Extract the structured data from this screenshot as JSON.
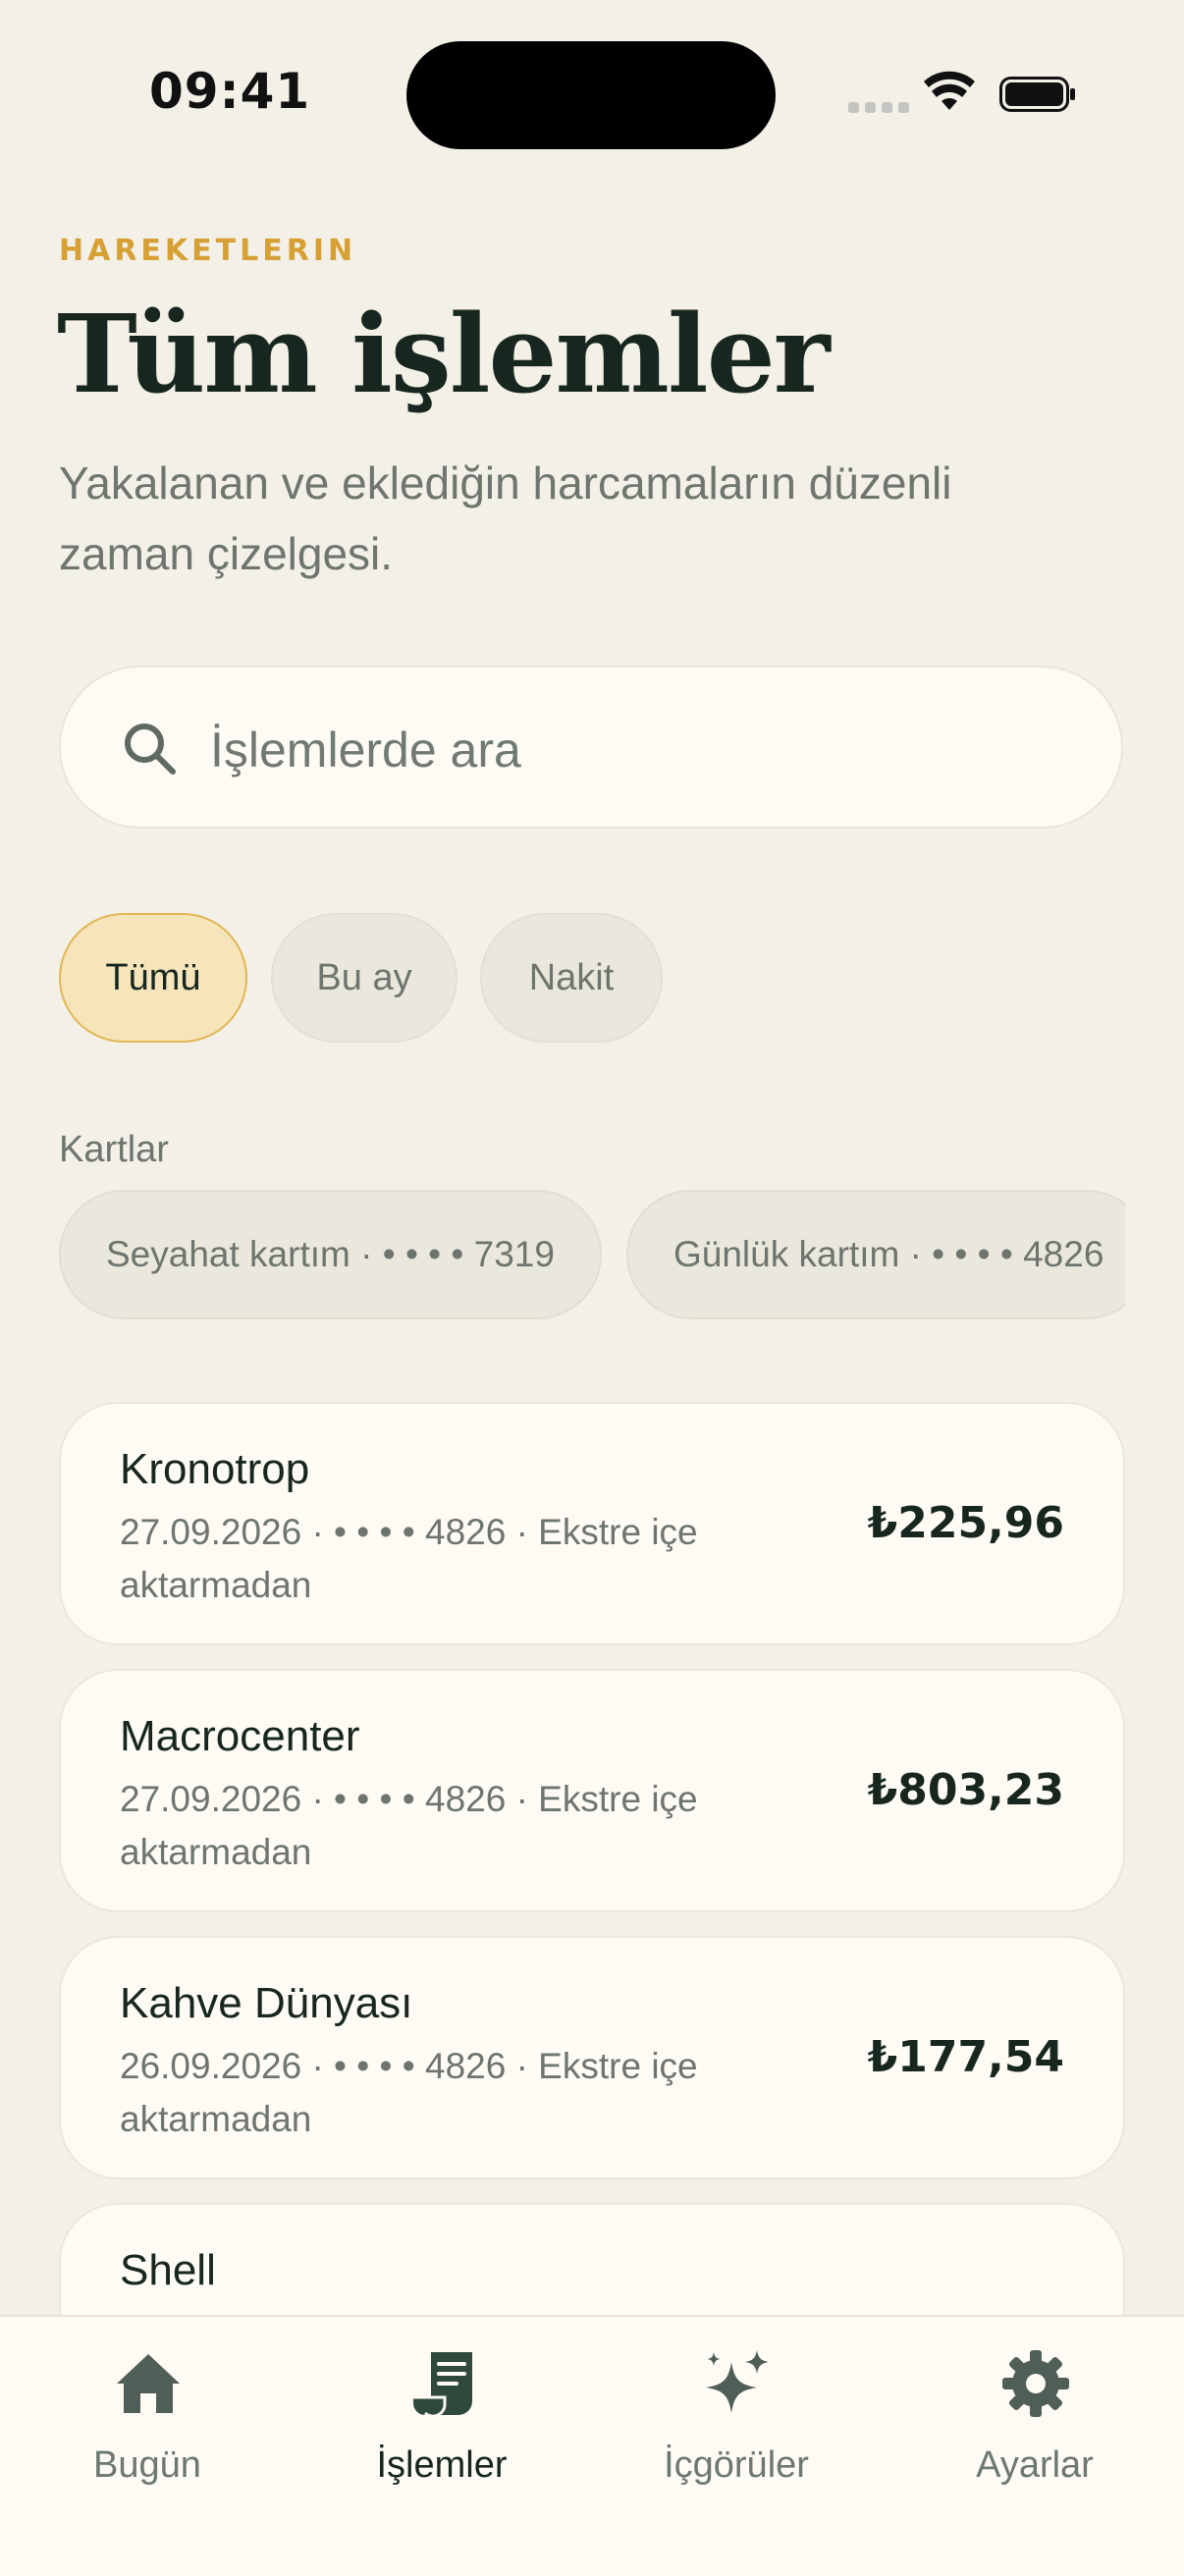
{
  "status_bar": {
    "time": "09:41"
  },
  "header": {
    "eyebrow": "HAREKETLERIN",
    "title": "Tüm işlemler",
    "subtitle": "Yakalanan ve eklediğin harcamaların düzenli zaman çizelgesi."
  },
  "search": {
    "placeholder": "İşlemlerde ara",
    "value": ""
  },
  "filters": [
    {
      "label": "Tümü",
      "active": true
    },
    {
      "label": "Bu ay",
      "active": false
    },
    {
      "label": "Nakit",
      "active": false
    }
  ],
  "cards": {
    "section_label": "Kartlar",
    "items": [
      {
        "label": "Seyahat kartım · • • • • 7319"
      },
      {
        "label": "Günlük kartım · • • • • 4826"
      }
    ]
  },
  "transactions": [
    {
      "merchant": "Kronotrop",
      "meta": "27.09.2026 · • • • • 4826 · Ekstre içe aktarmadan",
      "amount": "₺225,96"
    },
    {
      "merchant": "Macrocenter",
      "meta": "27.09.2026 · • • • • 4826 · Ekstre içe aktarmadan",
      "amount": "₺803,23"
    },
    {
      "merchant": "Kahve Dünyası",
      "meta": "26.09.2026 · • • • • 4826 · Ekstre içe aktarmadan",
      "amount": "₺177,54"
    },
    {
      "merchant": "Shell",
      "meta": "",
      "amount": ""
    }
  ],
  "tabbar": [
    {
      "label": "Bugün",
      "icon": "home-icon",
      "active": false
    },
    {
      "label": "İşlemler",
      "icon": "receipt-icon",
      "active": true
    },
    {
      "label": "İçgörüler",
      "icon": "sparkles-icon",
      "active": false
    },
    {
      "label": "Ayarlar",
      "icon": "gear-icon",
      "active": false
    }
  ],
  "colors": {
    "background": "#f3f0e7",
    "accent": "#d6a034",
    "active_chip": "#f6e5bb",
    "text_dark": "#17271f",
    "text_muted": "#6e756f"
  }
}
